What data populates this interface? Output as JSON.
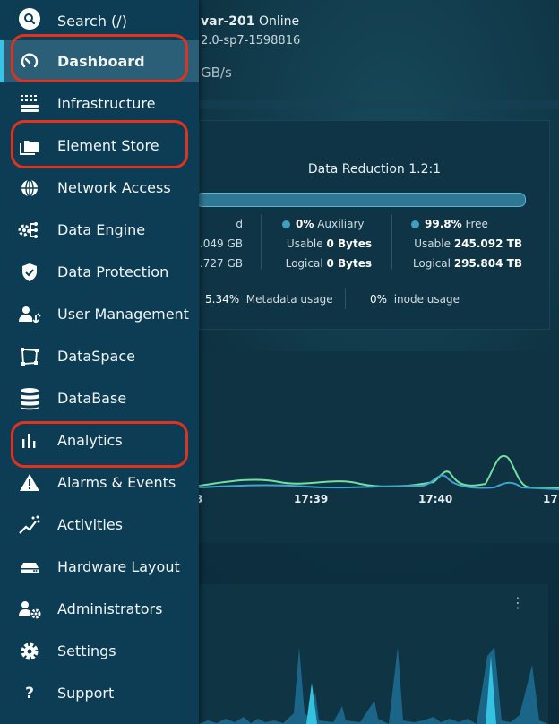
{
  "cluster": {
    "name": "var-201",
    "status": "Online",
    "version": "2.0-sp7-1598816",
    "throughput": "GB/s"
  },
  "capacity": {
    "title": "Data Reduction 1.2:1",
    "col1": {
      "tail": "d",
      "usable": ".049 GB",
      "logical": ".727 GB"
    },
    "col2": {
      "percent": "0%",
      "name": "Auxiliary",
      "usable_label": "Usable",
      "usable": "0 Bytes",
      "logical_label": "Logical",
      "logical": "0 Bytes"
    },
    "col3": {
      "percent": "99.8%",
      "name": "Free",
      "usable_label": "Usable",
      "usable": "245.092 TB",
      "logical_label": "Logical",
      "logical": "295.804 TB"
    },
    "metadata_pct": "5.34%",
    "metadata_label": "Metadata usage",
    "inode_pct": "0%",
    "inode_label": "inode usage"
  },
  "throughput_chart": {
    "ticks": [
      "17:39",
      "17:40",
      "17"
    ],
    "left_tick": "3"
  },
  "chart_menu": "⋮",
  "sidebar": {
    "items": [
      {
        "label": "Search (/)",
        "icon": "search-icon"
      },
      {
        "label": "Dashboard",
        "icon": "dashboard-gauge-icon"
      },
      {
        "label": "Infrastructure",
        "icon": "infrastructure-icon"
      },
      {
        "label": "Element Store",
        "icon": "folders-icon"
      },
      {
        "label": "Network Access",
        "icon": "globe-icon"
      },
      {
        "label": "Data Engine",
        "icon": "data-engine-icon"
      },
      {
        "label": "Data Protection",
        "icon": "shield-icon"
      },
      {
        "label": "User Management",
        "icon": "user-management-icon"
      },
      {
        "label": "DataSpace",
        "icon": "dataspace-icon"
      },
      {
        "label": "DataBase",
        "icon": "database-icon"
      },
      {
        "label": "Analytics",
        "icon": "bar-chart-icon"
      },
      {
        "label": "Alarms & Events",
        "icon": "warning-icon"
      },
      {
        "label": "Activities",
        "icon": "activity-icon"
      },
      {
        "label": "Hardware Layout",
        "icon": "hardware-drive-icon"
      },
      {
        "label": "Administrators",
        "icon": "admin-user-gear-icon"
      },
      {
        "label": "Settings",
        "icon": "gear-icon"
      },
      {
        "label": "Support",
        "icon": "question-icon"
      }
    ],
    "active": "Dashboard"
  },
  "colors": {
    "highlight": "#e1321e",
    "accent": "#36c3e6",
    "sidebar": "#0d3d55"
  }
}
